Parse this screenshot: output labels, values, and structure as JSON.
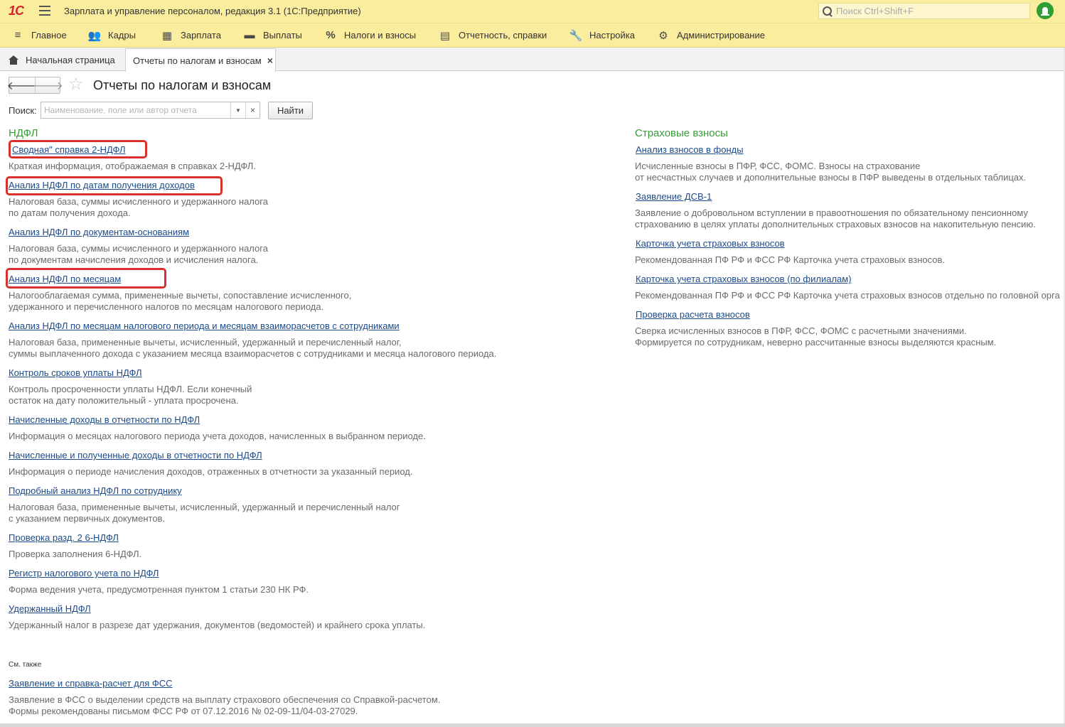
{
  "app": {
    "logo": "1С",
    "title": "Зарплата и управление персоналом, редакция 3.1  (1С:Предприятие)",
    "search_placeholder": "Поиск Ctrl+Shift+F"
  },
  "menu": [
    {
      "label": "Главное",
      "icon": "hamburger-icon"
    },
    {
      "label": "Кадры",
      "icon": "people-icon"
    },
    {
      "label": "Зарплата",
      "icon": "calculator-icon"
    },
    {
      "label": "Выплаты",
      "icon": "wallet-icon"
    },
    {
      "label": "Налоги и взносы",
      "icon": "percent-icon"
    },
    {
      "label": "Отчетность, справки",
      "icon": "report-icon"
    },
    {
      "label": "Настройка",
      "icon": "wrench-icon"
    },
    {
      "label": "Администрирование",
      "icon": "gear-icon"
    }
  ],
  "tabs": {
    "home": "Начальная страница",
    "active": "Отчеты по налогам и взносам",
    "close": "×"
  },
  "form": {
    "title": "Отчеты по налогам и взносам",
    "back": "🡐",
    "forward": "🡒",
    "star": "☆",
    "search_label": "Поиск:",
    "search_placeholder": "Наименование, поле или автор отчета",
    "search_value": "",
    "dropdown": "▼",
    "clear": "×",
    "find_button": "Найти"
  },
  "ndfl": {
    "title": "НДФЛ",
    "reports": [
      {
        "name": "Сводная\" справка 2-НДФЛ",
        "desc": [
          "Краткая информация, отображаемая в справках 2-НДФЛ."
        ]
      },
      {
        "name": "Анализ НДФЛ по датам получения доходов",
        "desc": [
          "Налоговая база, суммы исчисленного и удержанного налога",
          "по датам получения дохода."
        ]
      },
      {
        "name": "Анализ НДФЛ по документам-основаниям",
        "desc": [
          "Налоговая база, суммы исчисленного и удержанного налога",
          "по документам начисления доходов и исчисления налога."
        ]
      },
      {
        "name": "Анализ НДФЛ по месяцам",
        "desc": [
          "Налогооблагаемая сумма, примененные вычеты, сопоставление исчисленного,",
          "удержанного и перечисленного налогов по месяцам налогового периода."
        ]
      },
      {
        "name": "Анализ НДФЛ по месяцам налогового периода и месяцам взаиморасчетов с сотрудниками",
        "desc": [
          "Налоговая база, примененные вычеты, исчисленный, удержанный и перечисленный налог,",
          "суммы выплаченного дохода с указанием месяца взаиморасчетов с сотрудниками и месяца налогового периода."
        ]
      },
      {
        "name": "Контроль сроков уплаты НДФЛ",
        "desc": [
          "Контроль просроченности уплаты НДФЛ. Если конечный",
          "остаток на дату положительный - уплата просрочена."
        ]
      },
      {
        "name": "Начисленные доходы в отчетности по НДФЛ",
        "desc": [
          "Информация о месяцах налогового периода учета доходов, начисленных в выбранном периоде."
        ]
      },
      {
        "name": "Начисленные и полученные доходы в отчетности по НДФЛ",
        "desc": [
          "Информация о периоде начисления доходов, отраженных в отчетности за указанный период."
        ]
      },
      {
        "name": "Подробный анализ НДФЛ по сотруднику",
        "desc": [
          "Налоговая база, примененные вычеты, исчисленный, удержанный и перечисленный налог",
          "с указанием первичных документов."
        ]
      },
      {
        "name": "Проверка разд. 2 6-НДФЛ",
        "desc": [
          "Проверка заполнения 6-НДФЛ."
        ]
      },
      {
        "name": "Регистр налогового учета по НДФЛ",
        "desc": [
          "Форма ведения учета, предусмотренная пунктом 1 статьи 230 НК РФ."
        ]
      },
      {
        "name": "Удержанный НДФЛ",
        "desc": [
          "Удержанный налог в разрезе дат удержания, документов (ведомостей) и крайнего срока уплаты."
        ]
      }
    ]
  },
  "insurance": {
    "title": "Страховые взносы",
    "reports": [
      {
        "name": "Анализ взносов в фонды",
        "desc": [
          "Исчисленные взносы в ПФР, ФСС, ФОМС. Взносы на страхование",
          "от несчастных случаев и дополнительные взносы в ПФР выведены в отдельных таблицах."
        ]
      },
      {
        "name": "Заявление ДСВ-1",
        "desc": [
          "Заявление о добровольном вступлении в правоотношения по обязательному пенсионному",
          "страхованию в целях уплаты дополнительных страховых взносов на накопительную пенсию."
        ]
      },
      {
        "name": "Карточка учета страховых взносов",
        "desc": [
          "Рекомендованная ПФ РФ и ФСС РФ Карточка учета страховых взносов."
        ]
      },
      {
        "name": "Карточка учета страховых взносов (по филиалам)",
        "desc": [
          "Рекомендованная ПФ РФ и ФСС РФ Карточка учета страховых взносов отдельно по головной орга"
        ]
      },
      {
        "name": "Проверка расчета взносов",
        "desc": [
          "Сверка исчисленных взносов в ПФР, ФСС, ФОМС с расчетными значениями.",
          "Формируется по сотрудникам, неверно рассчитанные взносы выделяются красным."
        ]
      }
    ]
  },
  "see_also": {
    "title": "См. также",
    "reports": [
      {
        "name": "Заявление и справка-расчет для ФСС",
        "desc": [
          "Заявление в ФСС о выделении средств на выплату страхового обеспечения со Справкой-расчетом.",
          "Формы рекомендованы письмом ФСС РФ от 07.12.2016 № 02-09-11/04-03-27029."
        ]
      }
    ]
  },
  "colors": {
    "header_bg": "#fbed9e",
    "section_title": "#3a9a3a",
    "link": "#1c4b8a",
    "highlight": "#d8302b"
  }
}
